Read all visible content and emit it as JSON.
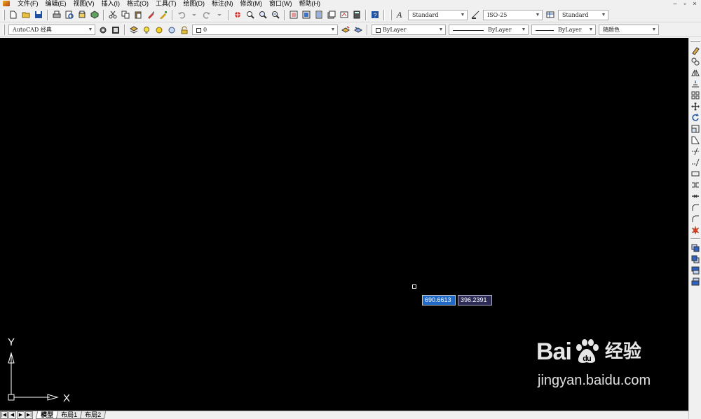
{
  "menu": [
    "文件(F)",
    "编辑(E)",
    "视图(V)",
    "插入(I)",
    "格式(O)",
    "工具(T)",
    "绘图(D)",
    "标注(N)",
    "修改(M)",
    "窗口(W)",
    "帮助(H)"
  ],
  "window_controls": [
    "–",
    "▫",
    "×"
  ],
  "toolbar_top": {
    "text_style": "Standard",
    "dim_style": "ISO-25",
    "table_style": "Standard"
  },
  "toolbar_second": {
    "workspace": "AutoCAD 经典",
    "layer": "0",
    "color": "ByLayer",
    "linetype": "ByLayer",
    "lineweight": "ByLayer",
    "plot_style": "随颜色"
  },
  "canvas": {
    "background": "#000000",
    "dynamic_input_x": "690.6613",
    "dynamic_input_y": "396.2391",
    "ucs_x_label": "X",
    "ucs_y_label": "Y"
  },
  "watermark": {
    "logo_text_left": "Bai",
    "logo_text_right": "经验",
    "url": "jingyan.baidu.com"
  },
  "layout_tabs": {
    "nav": [
      "|◀",
      "◀",
      "▶",
      "▶|"
    ],
    "tabs": [
      "模型",
      "布局1",
      "布局2"
    ],
    "active": "模型"
  },
  "colors": {
    "accent": "#1e68c8",
    "ui_bg": "#f0f0f0"
  }
}
